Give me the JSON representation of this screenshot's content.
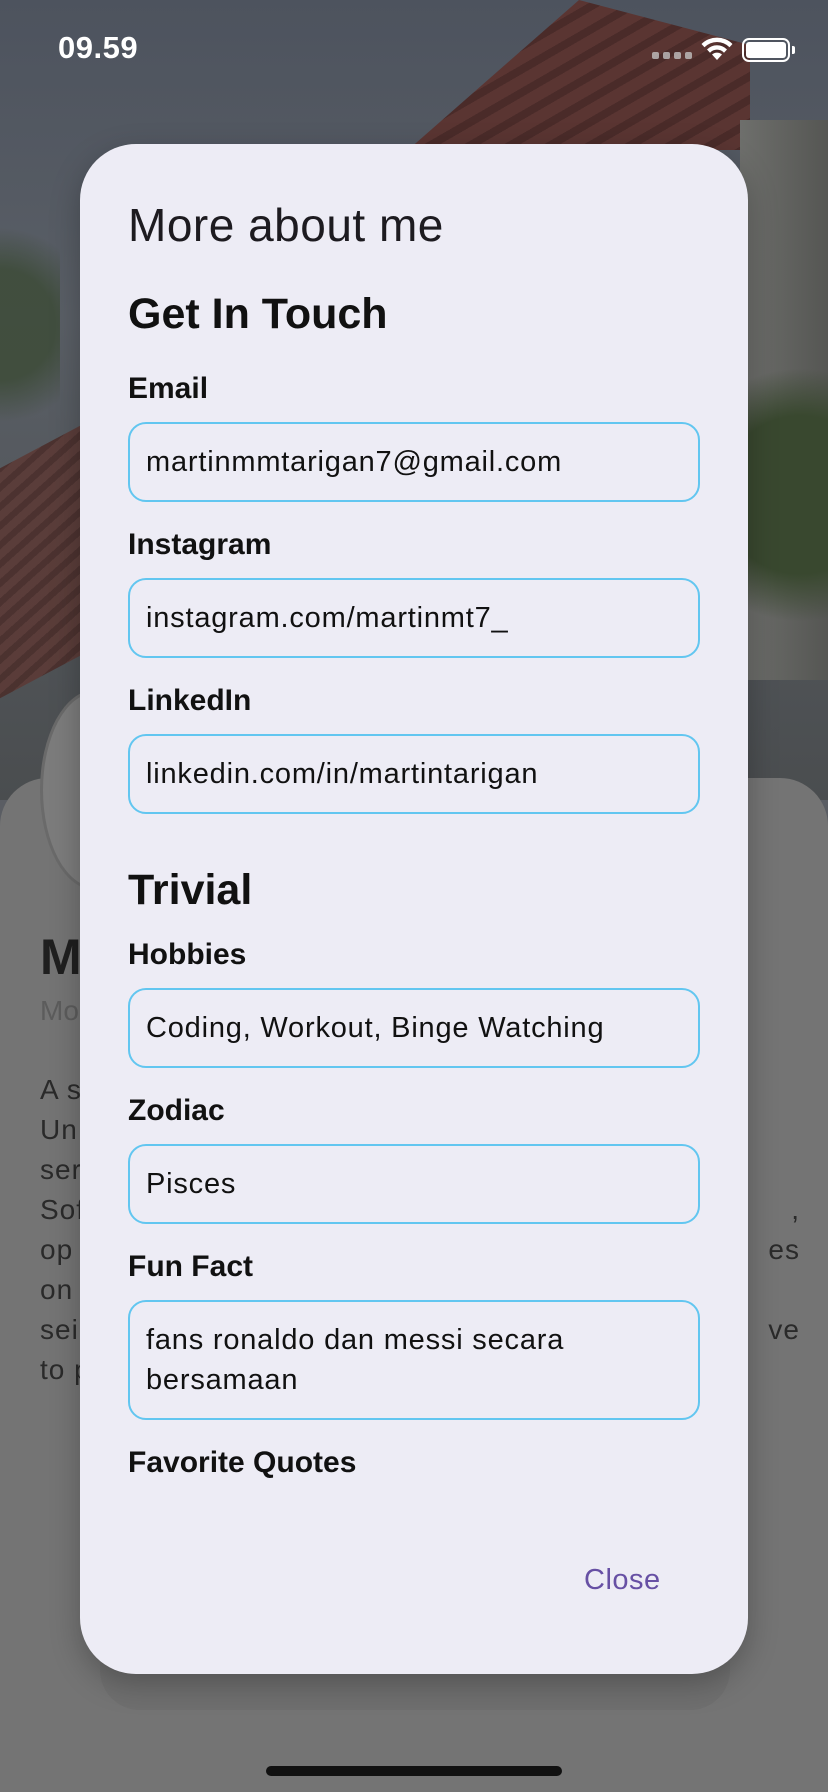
{
  "status_bar": {
    "time": "09.59"
  },
  "background": {
    "profile_name": "M",
    "profile_subtitle": "Mo",
    "about_lines": [
      {
        "left": "A s",
        "right": ""
      },
      {
        "left": "Un",
        "right": ""
      },
      {
        "left": "ser",
        "right": ""
      },
      {
        "left": "Sof",
        "right": ","
      },
      {
        "left": "op",
        "right": "es"
      },
      {
        "left": "on",
        "right": ""
      },
      {
        "left": "sei",
        "right": "ve"
      },
      {
        "left": "to p",
        "right": ""
      }
    ]
  },
  "dialog": {
    "title": "More about me",
    "get_in_touch": {
      "heading": "Get In Touch",
      "email": {
        "label": "Email",
        "value": "martinmmtarigan7@gmail.com"
      },
      "instagram": {
        "label": "Instagram",
        "value": "instagram.com/martinmt7_"
      },
      "linkedin": {
        "label": "LinkedIn",
        "value": "linkedin.com/in/martintarigan"
      }
    },
    "trivial": {
      "heading": "Trivial",
      "hobbies": {
        "label": "Hobbies",
        "value": "Coding, Workout, Binge Watching"
      },
      "zodiac": {
        "label": "Zodiac",
        "value": "Pisces"
      },
      "fun_fact": {
        "label": "Fun Fact",
        "value": "fans ronaldo dan messi secara bersamaan"
      },
      "favorite_quotes": {
        "label": "Favorite Quotes"
      }
    },
    "close_label": "Close"
  },
  "colors": {
    "dialog_background": "#edecf5",
    "field_border": "#62c6f0",
    "close_button": "#6750a4"
  }
}
